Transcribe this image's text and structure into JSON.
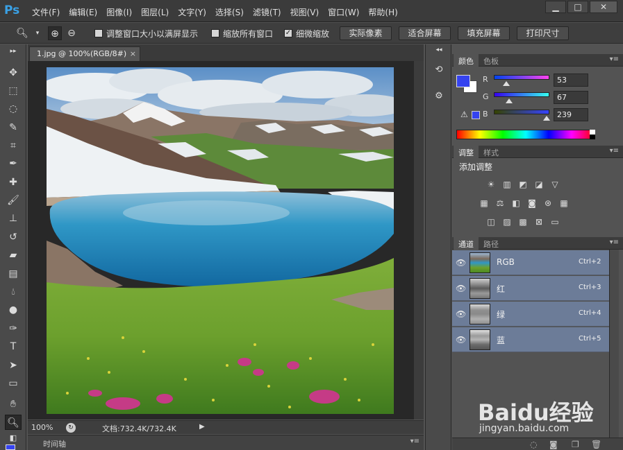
{
  "app": {
    "logo": "Ps",
    "menu": [
      "文件(F)",
      "编辑(E)",
      "图像(I)",
      "图层(L)",
      "文字(Y)",
      "选择(S)",
      "滤镜(T)",
      "视图(V)",
      "窗口(W)",
      "帮助(H)"
    ],
    "window_buttons": {
      "minimize": "▁",
      "restore": "□",
      "close": "✕"
    }
  },
  "options": {
    "resize_window": {
      "label": "调整窗口大小以满屏显示",
      "checked": false
    },
    "zoom_all": {
      "label": "缩放所有窗口",
      "checked": false
    },
    "scrubby_zoom": {
      "label": "细微缩放",
      "checked": true
    },
    "buttons": [
      "实际像素",
      "适合屏幕",
      "填充屏幕",
      "打印尺寸"
    ]
  },
  "document": {
    "tab_title": "1.jpg @ 100%(RGB/8#)",
    "tab_close": "×",
    "zoom": "100%",
    "doc_size": "文档:732.4K/732.4K",
    "timeline_label": "时间轴"
  },
  "color_panel": {
    "tabs": [
      "颜色",
      "色板"
    ],
    "foreground": "#3543ef",
    "background": "#ffffff",
    "channels": [
      {
        "label": "R",
        "value": "53"
      },
      {
        "label": "G",
        "value": "67"
      },
      {
        "label": "B",
        "value": "239"
      }
    ]
  },
  "adjustments_panel": {
    "tabs": [
      "调整",
      "样式"
    ],
    "title": "添加调整"
  },
  "channels_panel": {
    "tabs": [
      "通道",
      "路径"
    ],
    "rows": [
      {
        "name": "RGB",
        "shortcut": "Ctrl+2"
      },
      {
        "name": "红",
        "shortcut": "Ctrl+3"
      },
      {
        "name": "绿",
        "shortcut": "Ctrl+4"
      },
      {
        "name": "蓝",
        "shortcut": "Ctrl+5"
      }
    ]
  },
  "watermark": {
    "brand": "Baidu经验",
    "url": "jingyan.baidu.com"
  }
}
